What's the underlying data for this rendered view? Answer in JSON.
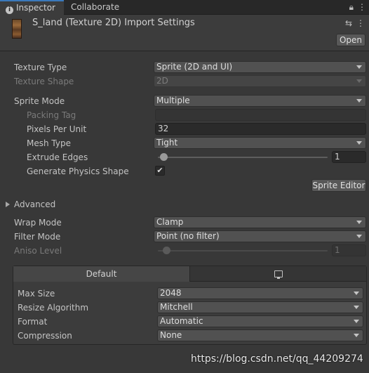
{
  "tabs": {
    "inspector": "Inspector",
    "collaborate": "Collaborate"
  },
  "header": {
    "title": "S_land (Texture 2D) Import Settings",
    "open_label": "Open"
  },
  "general": {
    "texture_type": {
      "label": "Texture Type",
      "value": "Sprite (2D and UI)"
    },
    "texture_shape": {
      "label": "Texture Shape",
      "value": "2D"
    },
    "sprite_mode": {
      "label": "Sprite Mode",
      "value": "Multiple"
    },
    "packing_tag": {
      "label": "Packing Tag",
      "value": ""
    },
    "pixels_per_unit": {
      "label": "Pixels Per Unit",
      "value": "32"
    },
    "mesh_type": {
      "label": "Mesh Type",
      "value": "Tight"
    },
    "extrude_edges": {
      "label": "Extrude Edges",
      "value": "1"
    },
    "generate_physics_shape": {
      "label": "Generate Physics Shape",
      "checked": true
    },
    "sprite_editor_label": "Sprite Editor"
  },
  "advanced": {
    "label": "Advanced"
  },
  "sampling": {
    "wrap_mode": {
      "label": "Wrap Mode",
      "value": "Clamp"
    },
    "filter_mode": {
      "label": "Filter Mode",
      "value": "Point (no filter)"
    },
    "aniso_level": {
      "label": "Aniso Level",
      "value": "1"
    }
  },
  "platform": {
    "tab_default": "Default",
    "max_size": {
      "label": "Max Size",
      "value": "2048"
    },
    "resize_algorithm": {
      "label": "Resize Algorithm",
      "value": "Mitchell"
    },
    "format": {
      "label": "Format",
      "value": "Automatic"
    },
    "compression": {
      "label": "Compression",
      "value": "None"
    }
  },
  "watermark": "https://blog.csdn.net/qq_44209274",
  "colors": {
    "background": "#383838",
    "tab_accent": "#3a79bb",
    "dropdown_bg": "#515151",
    "field_bg": "#2a2a2a"
  }
}
